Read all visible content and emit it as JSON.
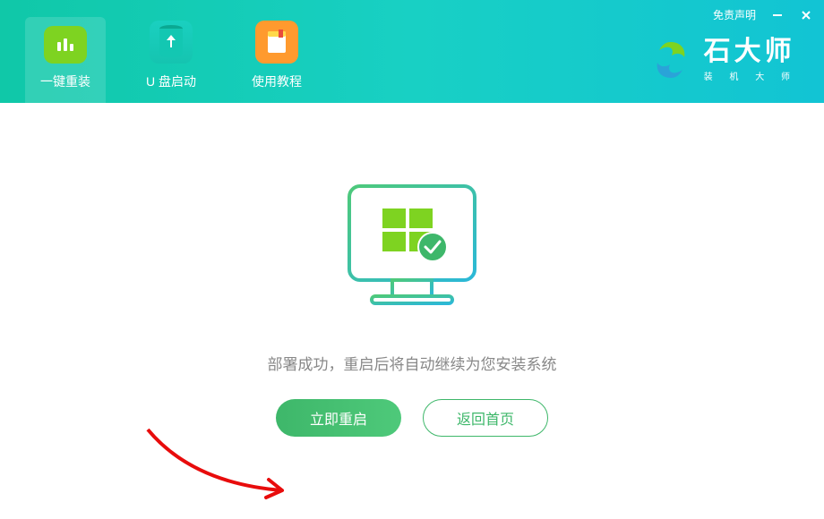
{
  "header": {
    "tabs": [
      {
        "label": "一键重装",
        "icon": "bars-icon"
      },
      {
        "label": "U 盘启动",
        "icon": "usb-icon"
      },
      {
        "label": "使用教程",
        "icon": "book-icon"
      }
    ],
    "disclaimer": "免责声明",
    "brand": {
      "name": "石大师",
      "tagline": "装 机 大 师"
    }
  },
  "main": {
    "status_text": "部署成功，重启后将自动继续为您安装系统",
    "primary_button": "立即重启",
    "secondary_button": "返回首页"
  }
}
